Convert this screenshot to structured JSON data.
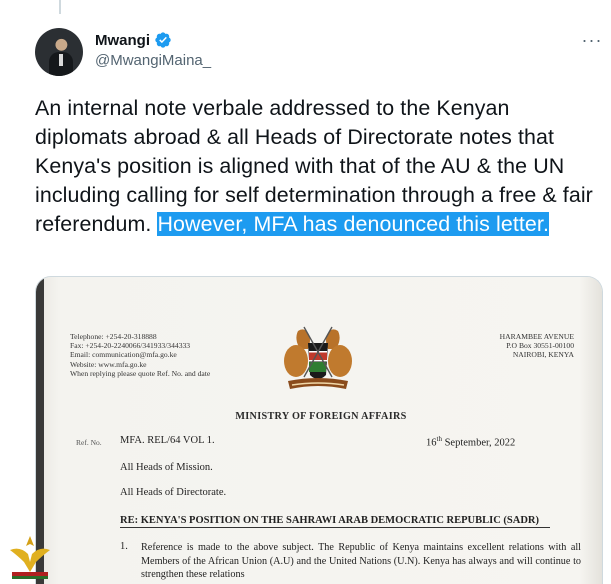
{
  "tweet": {
    "author_name": "Mwangi",
    "author_handle": "@MwangiMaina_",
    "text_main": "An internal note verbale addressed to the Kenyan diplomats abroad & all Heads of Directorate notes that Kenya's position is aligned with that of the AU & the UN including calling for self determination through a free & fair referendum.",
    "text_highlight": "However, MFA has denounced this letter.",
    "icons": {
      "verified": "verified-badge-icon",
      "more": "more-options-icon"
    },
    "colors": {
      "verified": "#1d9bf0",
      "highlight": "#1d9bf0"
    }
  },
  "document": {
    "contact_lines": [
      "Telephone: +254-20-318888",
      "Fax: +254-20-2240066/341933/344333",
      "Email: communication@mfa.go.ke",
      "Website: www.mfa.go.ke",
      "When replying please quote Ref. No. and date"
    ],
    "address_lines": [
      "HARAMBEE AVENUE",
      "P.O Box 30551-00100",
      "NAIROBI, KENYA"
    ],
    "ministry": "MINISTRY OF FOREIGN AFFAIRS",
    "ref_label": "Ref. No.",
    "ref_value": "MFA. REL/64 VOL 1.",
    "date_day": "16",
    "date_suffix": "th",
    "date_rest": " September, 2022",
    "addressee_1": "All Heads of Mission.",
    "addressee_2": "All Heads of Directorate.",
    "subject": "RE: KENYA'S POSITION ON THE SAHRAWI ARAB DEMOCRATIC REPUBLIC (SADR)",
    "para_number": "1.",
    "para_text": "Reference is made to the above subject. The Republic of Kenya maintains excellent relations with all Members of the African Union (A.U) and the United Nations (U.N). Kenya has always and will continue to strengthen these relations"
  }
}
